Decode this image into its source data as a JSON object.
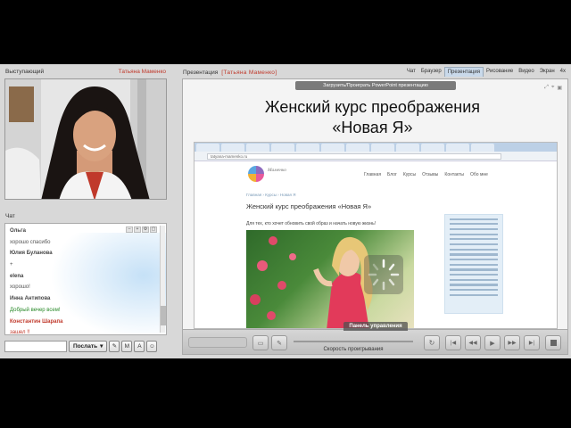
{
  "speaker_panel": {
    "title": "Выступающий",
    "name": "Татьяна Маменко"
  },
  "chat_panel": {
    "title": "Чат",
    "lines": [
      {
        "kind": "user",
        "text": "Ольга",
        "color": ""
      },
      {
        "kind": "msg",
        "text": "хорошо спасибо",
        "color": ""
      },
      {
        "kind": "user",
        "text": "Юлия Буланова",
        "color": ""
      },
      {
        "kind": "msg",
        "text": "+",
        "color": ""
      },
      {
        "kind": "user",
        "text": "elena",
        "color": ""
      },
      {
        "kind": "msg",
        "text": "хорошо!",
        "color": ""
      },
      {
        "kind": "user",
        "text": "Инна Антипова",
        "color": ""
      },
      {
        "kind": "msg",
        "text": "Добрый вечер всем!",
        "color": "green"
      },
      {
        "kind": "user",
        "text": "Константин Шарапа",
        "color": "red"
      },
      {
        "kind": "msg",
        "text": "зашел !!",
        "color": "red"
      }
    ],
    "send_label": "Послать"
  },
  "presentation": {
    "title": "Презентация",
    "presenter": "[Татьяна Маменко]",
    "tabs": [
      "Чат",
      "Браузер",
      "Презентация",
      "Рисование",
      "Видео",
      "Экран",
      "4х"
    ],
    "active_tab": "Презентация",
    "upload_label": "Загрузить/Проиграть PowerPoint презентацию",
    "slide_title_line1": "Женский курс преображения",
    "slide_title_line2": "«Новая Я»",
    "site": {
      "url": "tatyana-mamenko.ru",
      "brand": "Маменко",
      "nav": [
        "Главная",
        "Блог",
        "Курсы",
        "Отзывы",
        "Контакты",
        "Обо мне"
      ],
      "breadcrumb": "Главная › Курсы › Новая Я",
      "heading": "Женский курс преображения «Новая Я»",
      "intro": "Для тех, кто хочет обновить свой образ и начать новую жизнь!"
    },
    "control_panel_label": "Панель управления",
    "speed_label": "Скорость проигрывания"
  }
}
